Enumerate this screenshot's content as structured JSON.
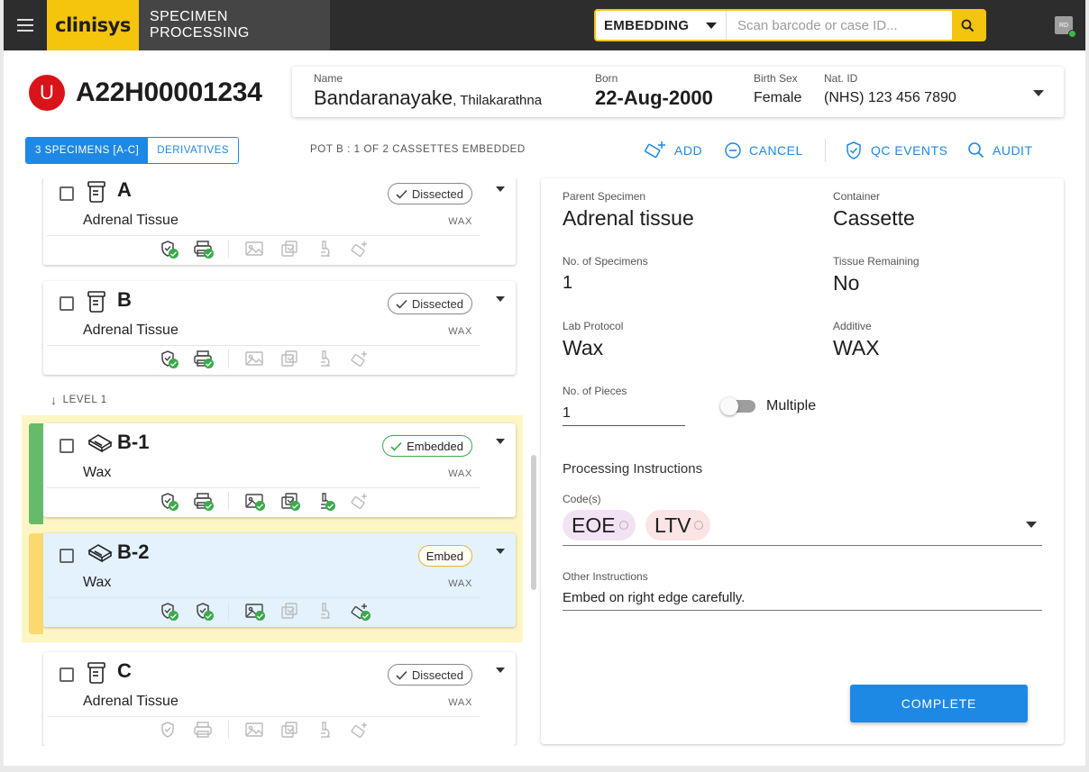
{
  "app": {
    "logo": "clinisys",
    "module": "SPECIMEN PROCESSING",
    "stage": "EMBEDDING",
    "search_placeholder": "Scan barcode or case ID...",
    "user_initials": "RD"
  },
  "case": {
    "badge": "U",
    "id": "A22H00001234"
  },
  "patient": {
    "name_label": "Name",
    "surname": "Bandaranayake",
    "given_name": ", Thilakarathna",
    "born_label": "Born",
    "born": "22-Aug-2000",
    "sex_label": "Birth Sex",
    "sex": "Female",
    "natid_label": "Nat. ID",
    "natid": "(NHS) 123 456 7890"
  },
  "toolbar": {
    "tab_specimens": "3 SPECIMENS [A-C]",
    "tab_derivatives": "DERIVATIVES",
    "pot_status": "POT B : 1 OF 2 CASSETTES EMBEDDED",
    "add": "ADD",
    "cancel": "CANCEL",
    "qc_events": "QC EVENTS",
    "audit": "AUDIT"
  },
  "level_label": "LEVEL 1",
  "specimens": [
    {
      "label": "A",
      "desc": "Adrenal Tissue",
      "additive": "WAX",
      "status": "Dissected"
    },
    {
      "label": "B",
      "desc": "Adrenal Tissue",
      "additive": "WAX",
      "status": "Dissected"
    },
    {
      "label": "B-1",
      "desc": "Wax",
      "additive": "WAX",
      "status": "Embedded"
    },
    {
      "label": "B-2",
      "desc": "Wax",
      "additive": "WAX",
      "status": "Embed"
    },
    {
      "label": "C",
      "desc": "Adrenal Tissue",
      "additive": "WAX",
      "status": "Dissected"
    }
  ],
  "detail": {
    "parent_label": "Parent Specimen",
    "parent_value": "Adrenal tissue",
    "container_label": "Container",
    "container_value": "Cassette",
    "num_specimens_label": "No. of Specimens",
    "num_specimens_value": "1",
    "tissue_remaining_label": "Tissue Remaining",
    "tissue_remaining_value": "No",
    "protocol_label": "Lab Protocol",
    "protocol_value": "Wax",
    "additive_label": "Additive",
    "additive_value": "WAX",
    "pieces_label": "No. of Pieces",
    "pieces_value": "1",
    "multiple_label": "Multiple",
    "processing_title": "Processing Instructions",
    "codes_label": "Code(s)",
    "codes": [
      "EOE",
      "LTV"
    ],
    "other_label": "Other Instructions",
    "other_value": "Embed on right edge carefully.",
    "complete": "COMPLETE"
  },
  "colors": {
    "brand_yellow": "#f5c40c",
    "accent_blue": "#1e88e5",
    "case_red": "#d8141a",
    "ok_green": "#3aaa4a",
    "embed_yellow": "#fdd86e",
    "selected_blue": "#e3f2fd"
  }
}
